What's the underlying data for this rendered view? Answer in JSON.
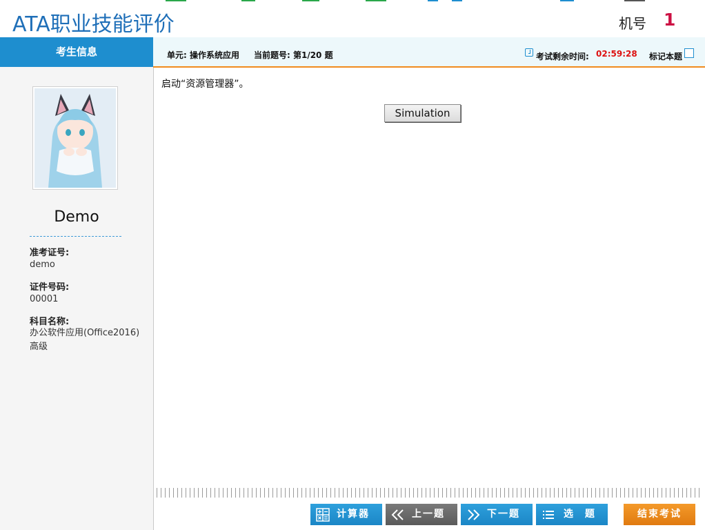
{
  "header": {
    "title": "ATA职业技能评价",
    "machine_label": "机号",
    "machine_number": "1"
  },
  "sidebar": {
    "heading": "考生信息",
    "name": "Demo",
    "fields": [
      {
        "label": "准考证号:",
        "value": "demo"
      },
      {
        "label": "证件号码:",
        "value": "00001"
      },
      {
        "label": "科目名称:",
        "value": "办公软件应用(Office2016)",
        "value2": "高级"
      }
    ]
  },
  "infobar": {
    "unit": "单元:  操作系统应用",
    "current": "当前题号: 第1/20 题",
    "time_label": "考试剩余时间:",
    "time_value": "02:59:28",
    "mark_label": "标记本题"
  },
  "question": {
    "text": "启动“资源管理器”。",
    "sim_button": "Simulation"
  },
  "toolbar": {
    "calculator": "计算器",
    "prev": "上一题",
    "next": "下一题",
    "select": "选 题",
    "finish": "结束考试"
  },
  "colors": {
    "accent_blue": "#1e8ecf",
    "title_blue": "#1f6fb8",
    "time_red": "#dd1111",
    "orange": "#f08a1c",
    "machine_red": "#cc1144"
  }
}
